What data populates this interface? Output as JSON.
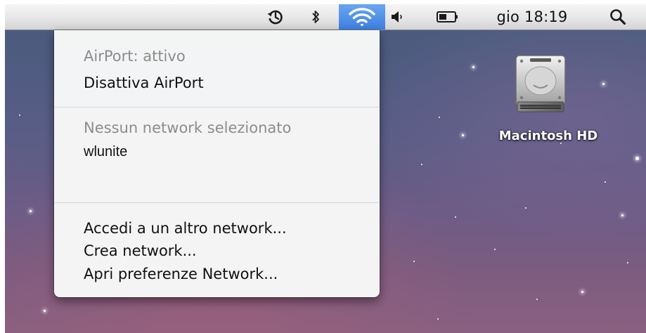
{
  "menubar": {
    "icons": {
      "time_machine": "clock-arrow-icon",
      "bluetooth": "bluetooth-icon",
      "wifi": "wifi-icon",
      "volume": "speaker-icon",
      "battery": "battery-icon",
      "spotlight": "magnifying-glass-icon"
    },
    "clock": "gio 18:19",
    "wifi_highlight_color": "#3d7fe0"
  },
  "airport_menu": {
    "status": "AirPort: attivo",
    "toggle_label": "Disattiva AirPort",
    "no_network_label": "Nessun network selezionato",
    "networks": [
      "wlunite"
    ],
    "join_other": "Accedi a un altro network...",
    "create_network": "Crea network...",
    "open_prefs": "Apri preferenze Network..."
  },
  "desktop": {
    "drive_label": "Macintosh HD",
    "drive_icon": "hard-drive-icon"
  }
}
